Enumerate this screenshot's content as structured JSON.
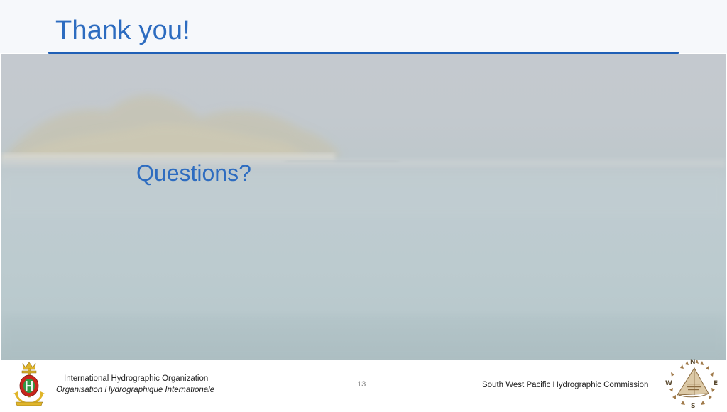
{
  "slide": {
    "title": "Thank you!",
    "body_text": "Questions?"
  },
  "footer": {
    "org_name_en": "International Hydrographic Organization",
    "org_name_fr": "Organisation Hydrographique Internationale",
    "page_number": "13",
    "commission_name": "South West Pacific Hydrographic Commission",
    "compass_letters": {
      "n": "N",
      "e": "E",
      "s": "S",
      "w": "W"
    }
  },
  "colors": {
    "accent_blue": "#2d6cc0",
    "rule_blue": "#1f5fb6"
  }
}
